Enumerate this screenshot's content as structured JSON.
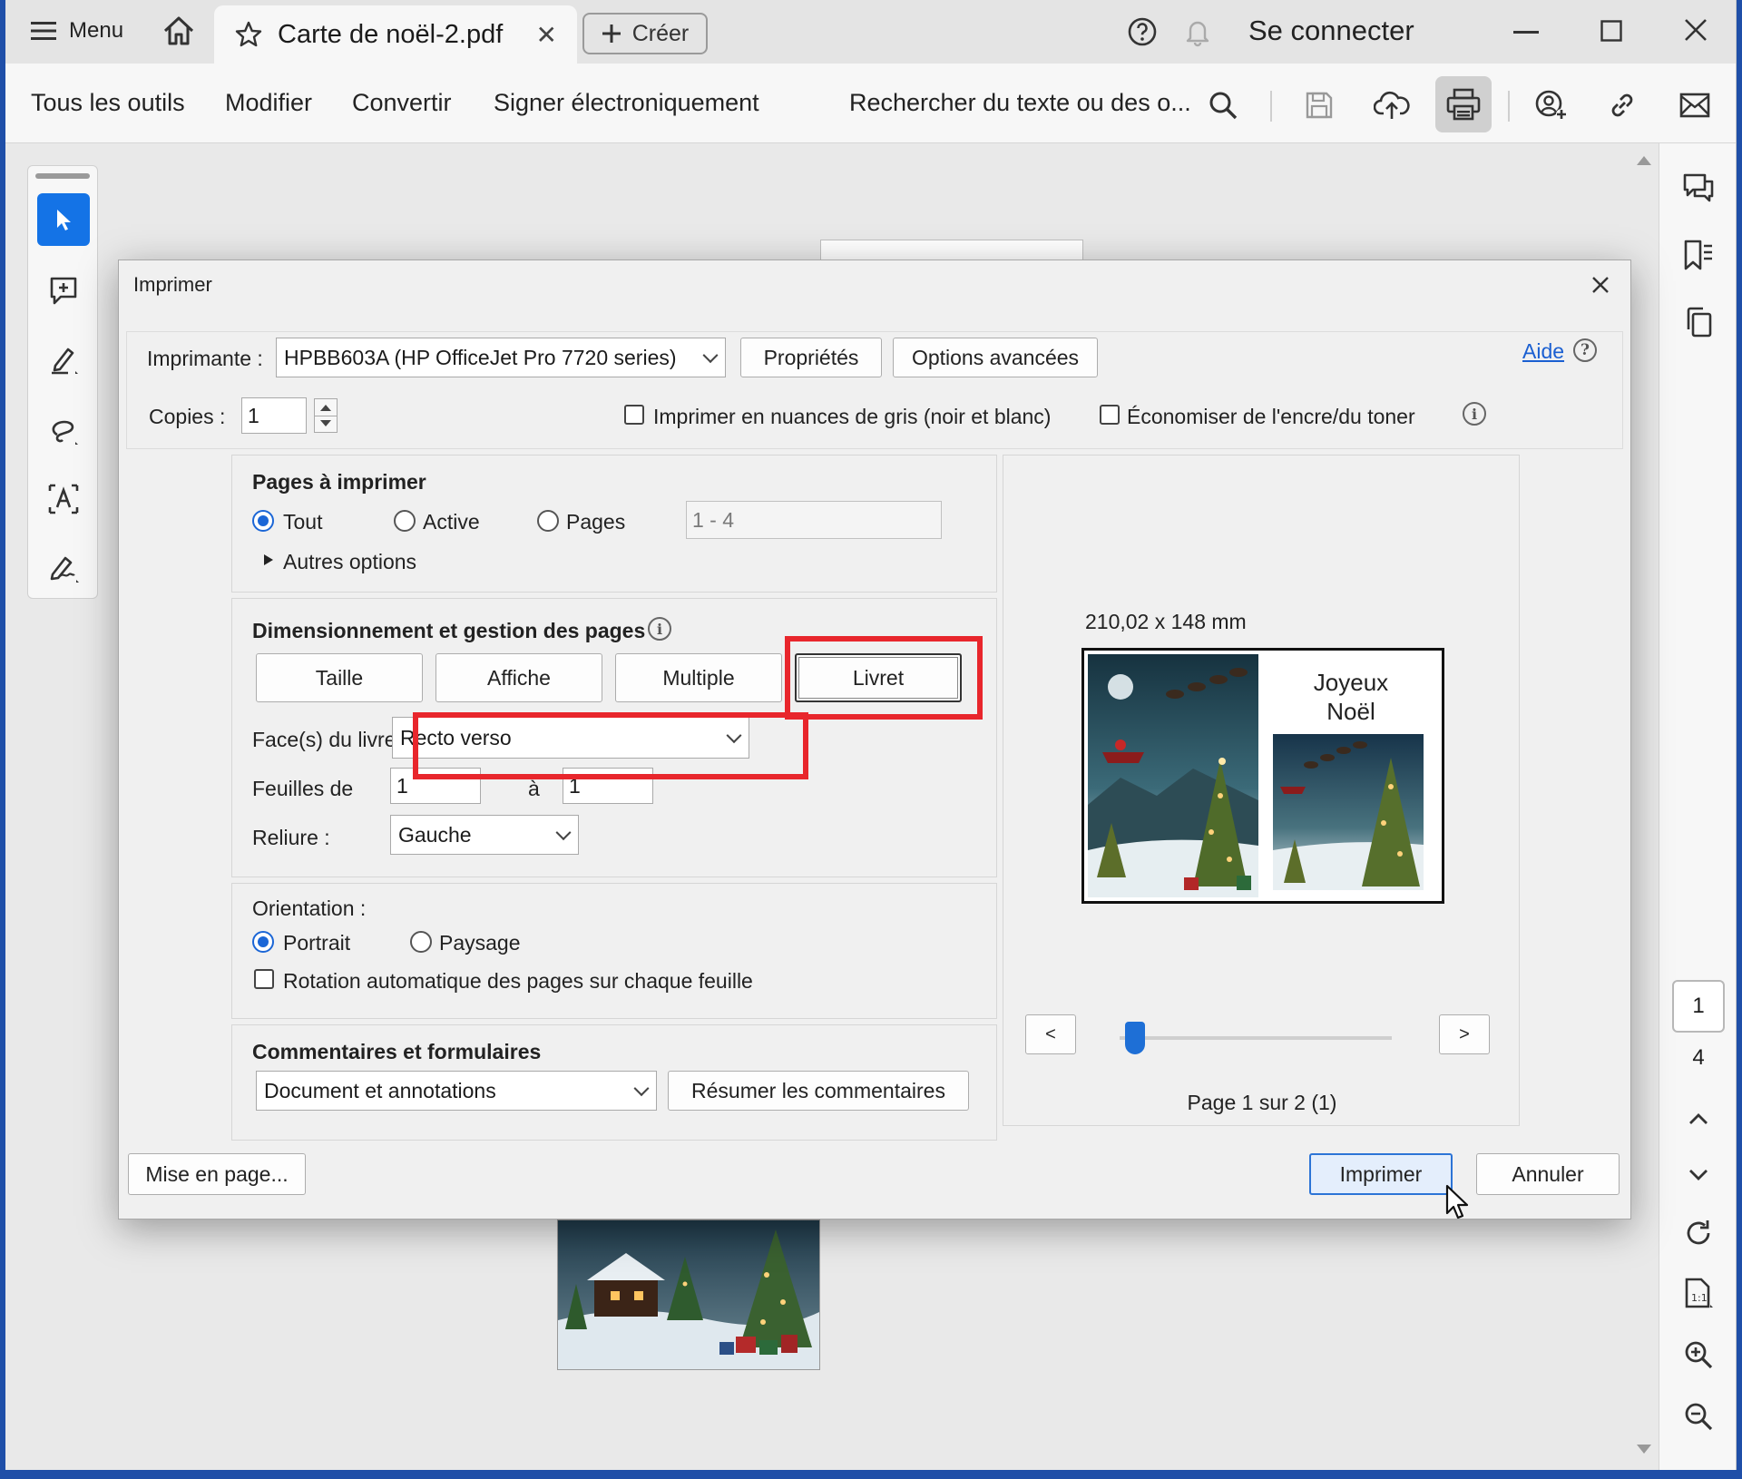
{
  "titlebar": {
    "menu_label": "Menu",
    "tab_title": "Carte de noël-2.pdf",
    "tab_close": "✕",
    "create_label": "Créer",
    "sign_in": "Se connecter"
  },
  "toolbar": {
    "all_tools": "Tous les outils",
    "edit": "Modifier",
    "convert": "Convertir",
    "sign": "Signer électroniquement",
    "search_text": "Rechercher du texte ou des o..."
  },
  "right_rail": {
    "current_page": "1",
    "total_pages": "4"
  },
  "dialog": {
    "title": "Imprimer",
    "printer_label": "Imprimante :",
    "printer_value": "HPBB603A (HP OfficeJet Pro 7720 series)",
    "properties_button": "Propriétés",
    "advanced_button": "Options avancées",
    "help_link": "Aide",
    "copies_label": "Copies :",
    "copies_value": "1",
    "grayscale_label": "Imprimer en nuances de gris (noir et blanc)",
    "save_ink_label": "Économiser de l'encre/du toner",
    "pages": {
      "heading": "Pages à imprimer",
      "all": "Tout",
      "current": "Active",
      "pages": "Pages",
      "range_value": "1 - 4",
      "more_options": "Autres options"
    },
    "sizing": {
      "heading": "Dimensionnement et gestion des pages",
      "size_tab": "Taille",
      "poster_tab": "Affiche",
      "multiple_tab": "Multiple",
      "booklet_tab": "Livret",
      "booklet_sides_label": "Face(s) du livret",
      "booklet_sides_value": "Recto verso",
      "sheets_label": "Feuilles de",
      "sheets_from": "1",
      "sheets_to_label": "à",
      "sheets_to": "1",
      "binding_label": "Reliure :",
      "binding_value": "Gauche"
    },
    "orientation": {
      "heading": "Orientation :",
      "portrait": "Portrait",
      "landscape": "Paysage",
      "auto_rotate": "Rotation automatique des pages sur chaque feuille"
    },
    "comments": {
      "heading": "Commentaires et formulaires",
      "value": "Document et annotations",
      "summarize_button": "Résumer les commentaires"
    },
    "preview": {
      "dimensions": "210,02 x 148 mm",
      "card_text_line1": "Joyeux",
      "card_text_line2": "Noël",
      "prev_button": "<",
      "next_button": ">",
      "page_status": "Page 1 sur 2 (1)",
      "slider_position_fraction": 0.0
    },
    "page_setup_button": "Mise en page...",
    "print_button": "Imprimer",
    "cancel_button": "Annuler"
  },
  "colors": {
    "accent": "#1473e6",
    "highlight": "#e8262c",
    "link": "#1a5fd1"
  }
}
